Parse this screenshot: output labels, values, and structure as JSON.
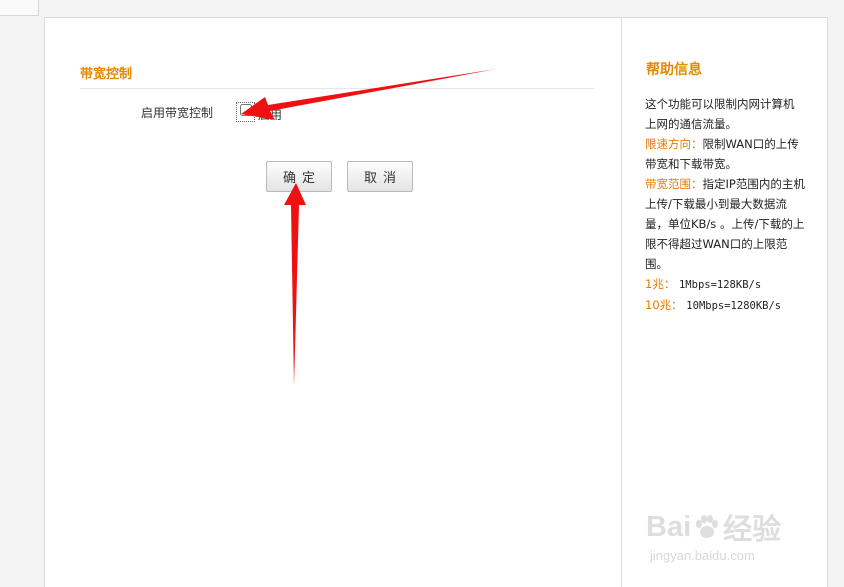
{
  "section": {
    "title": "带宽控制",
    "enable_label": "启用带宽控制",
    "checkbox_text": "启用",
    "ok_label": "确定",
    "cancel_label": "取消"
  },
  "help": {
    "title": "帮助信息",
    "intro": "这个功能可以限制内网计算机上网的通信流量。",
    "direction_label": "限速方向：",
    "direction_text": "限制WAN口的上传带宽和下载带宽。",
    "range_label": "带宽范围：",
    "range_text": "指定IP范围内的主机上传/下载最小到最大数据流量，单位KB/s 。上传/下载的上限不得超过WAN口的上限范围。",
    "one_label": "1兆：",
    "one_value": "1Mbps=128KB/s",
    "ten_label": "10兆：",
    "ten_value": "10Mbps=1280KB/s"
  },
  "watermark": {
    "brand_left": "Bai",
    "brand_right": "经验",
    "url": "jingyan.baidu.com"
  },
  "colors": {
    "accent": "#e58a00",
    "arrow": "#ee1111"
  }
}
